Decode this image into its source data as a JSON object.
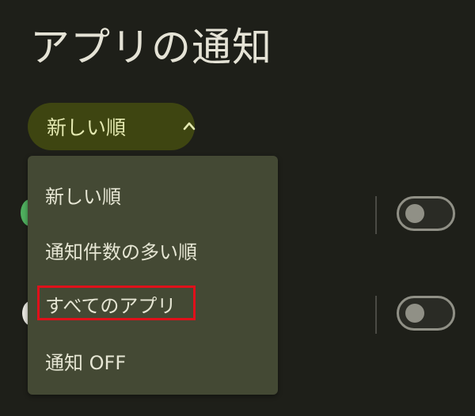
{
  "header": {
    "title": "アプリの通知"
  },
  "sort": {
    "selected_label": "新しい順",
    "chevron_icon": "chevron-up-icon",
    "options": [
      {
        "label": "新しい順"
      },
      {
        "label": "通知件数の多い順"
      },
      {
        "label": "すべてのアプリ"
      },
      {
        "label": "通知 OFF"
      }
    ]
  },
  "apps": [
    {
      "icon_color": "#4fae5e",
      "toggle_on": false
    },
    {
      "icon_color": "#e8e6df",
      "toggle_on": false
    }
  ],
  "annotation": {
    "highlighted_option": "すべてのアプリ",
    "color": "#e0101a"
  }
}
